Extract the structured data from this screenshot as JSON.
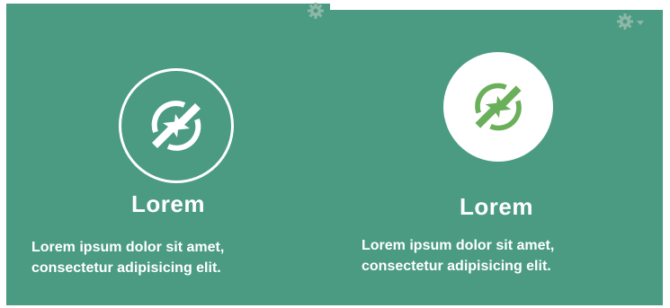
{
  "cards": [
    {
      "title": "Lorem",
      "text_line1": "Lorem ipsum dolor sit amet,",
      "text_line2": "consectetur adipisicing elit.",
      "icon": "sync-arrows-icon",
      "icon_style": "outline-ring"
    },
    {
      "title": "Lorem",
      "text_line1": "Lorem ipsum dolor sit amet,",
      "text_line2": "consectetur adipisicing elit.",
      "icon": "sync-arrows-icon",
      "icon_style": "filled-circle"
    }
  ],
  "colors": {
    "card_background": "#4a9b82",
    "icon_green": "#6aaf5a",
    "gear": "#8fb7a8",
    "text": "#ffffff"
  },
  "icons": {
    "settings": "gear-icon",
    "dropdown": "caret-down-icon"
  }
}
